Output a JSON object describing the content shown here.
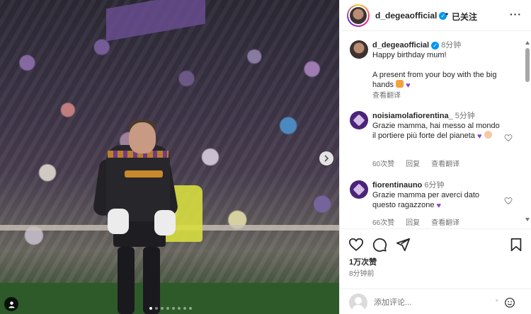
{
  "post": {
    "photo_alt": "",
    "dots_count": 8,
    "active_dot": 0
  },
  "header": {
    "username": "d_degeaofficial",
    "separator": "•",
    "follow_state": "已关注",
    "more": "···"
  },
  "caption": {
    "username": "d_degeaofficial",
    "time": "8分钟",
    "text_line1": "Happy birthday mum!",
    "text_line2": "A present from your boy with the big hands",
    "translate": "查看翻译"
  },
  "comments": [
    {
      "username": "noisiamolafiorentina_",
      "time": "5分钟",
      "text": "Grazie mamma, hai messo al mondo il portiere più forte del pianeta",
      "likes": "60次赞",
      "reply": "回复",
      "translate": "查看翻译"
    },
    {
      "username": "fiorentinauno",
      "time": "6分钟",
      "text": "Grazie mamma per averci dato questo ragazzone",
      "likes": "66次赞",
      "reply": "回复",
      "translate": "查看翻译"
    }
  ],
  "stats": {
    "likes": "1万次赞",
    "posted": "8分钟前"
  },
  "comment_bar": {
    "placeholder": "添加评论..."
  },
  "colors": {
    "verified": "#0095f6",
    "text": "#262626",
    "muted": "#737373",
    "purple_heart": "#8e44c7"
  },
  "icons": [
    "heart-icon",
    "comment-icon",
    "share-icon",
    "bookmark-icon",
    "emoji-icon",
    "verified-icon",
    "more-icon",
    "chevron-right-icon",
    "tag-user-icon"
  ]
}
